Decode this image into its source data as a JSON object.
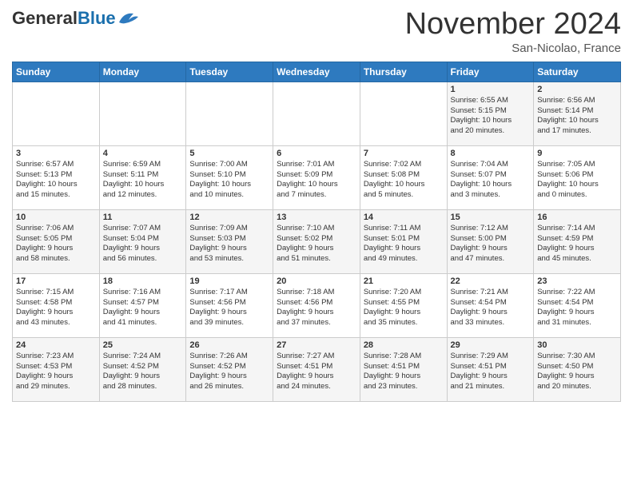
{
  "header": {
    "logo_general": "General",
    "logo_blue": "Blue",
    "month_title": "November 2024",
    "location": "San-Nicolao, France"
  },
  "calendar": {
    "days_of_week": [
      "Sunday",
      "Monday",
      "Tuesday",
      "Wednesday",
      "Thursday",
      "Friday",
      "Saturday"
    ],
    "weeks": [
      [
        {
          "day": "",
          "info": ""
        },
        {
          "day": "",
          "info": ""
        },
        {
          "day": "",
          "info": ""
        },
        {
          "day": "",
          "info": ""
        },
        {
          "day": "",
          "info": ""
        },
        {
          "day": "1",
          "info": "Sunrise: 6:55 AM\nSunset: 5:15 PM\nDaylight: 10 hours\nand 20 minutes."
        },
        {
          "day": "2",
          "info": "Sunrise: 6:56 AM\nSunset: 5:14 PM\nDaylight: 10 hours\nand 17 minutes."
        }
      ],
      [
        {
          "day": "3",
          "info": "Sunrise: 6:57 AM\nSunset: 5:13 PM\nDaylight: 10 hours\nand 15 minutes."
        },
        {
          "day": "4",
          "info": "Sunrise: 6:59 AM\nSunset: 5:11 PM\nDaylight: 10 hours\nand 12 minutes."
        },
        {
          "day": "5",
          "info": "Sunrise: 7:00 AM\nSunset: 5:10 PM\nDaylight: 10 hours\nand 10 minutes."
        },
        {
          "day": "6",
          "info": "Sunrise: 7:01 AM\nSunset: 5:09 PM\nDaylight: 10 hours\nand 7 minutes."
        },
        {
          "day": "7",
          "info": "Sunrise: 7:02 AM\nSunset: 5:08 PM\nDaylight: 10 hours\nand 5 minutes."
        },
        {
          "day": "8",
          "info": "Sunrise: 7:04 AM\nSunset: 5:07 PM\nDaylight: 10 hours\nand 3 minutes."
        },
        {
          "day": "9",
          "info": "Sunrise: 7:05 AM\nSunset: 5:06 PM\nDaylight: 10 hours\nand 0 minutes."
        }
      ],
      [
        {
          "day": "10",
          "info": "Sunrise: 7:06 AM\nSunset: 5:05 PM\nDaylight: 9 hours\nand 58 minutes."
        },
        {
          "day": "11",
          "info": "Sunrise: 7:07 AM\nSunset: 5:04 PM\nDaylight: 9 hours\nand 56 minutes."
        },
        {
          "day": "12",
          "info": "Sunrise: 7:09 AM\nSunset: 5:03 PM\nDaylight: 9 hours\nand 53 minutes."
        },
        {
          "day": "13",
          "info": "Sunrise: 7:10 AM\nSunset: 5:02 PM\nDaylight: 9 hours\nand 51 minutes."
        },
        {
          "day": "14",
          "info": "Sunrise: 7:11 AM\nSunset: 5:01 PM\nDaylight: 9 hours\nand 49 minutes."
        },
        {
          "day": "15",
          "info": "Sunrise: 7:12 AM\nSunset: 5:00 PM\nDaylight: 9 hours\nand 47 minutes."
        },
        {
          "day": "16",
          "info": "Sunrise: 7:14 AM\nSunset: 4:59 PM\nDaylight: 9 hours\nand 45 minutes."
        }
      ],
      [
        {
          "day": "17",
          "info": "Sunrise: 7:15 AM\nSunset: 4:58 PM\nDaylight: 9 hours\nand 43 minutes."
        },
        {
          "day": "18",
          "info": "Sunrise: 7:16 AM\nSunset: 4:57 PM\nDaylight: 9 hours\nand 41 minutes."
        },
        {
          "day": "19",
          "info": "Sunrise: 7:17 AM\nSunset: 4:56 PM\nDaylight: 9 hours\nand 39 minutes."
        },
        {
          "day": "20",
          "info": "Sunrise: 7:18 AM\nSunset: 4:56 PM\nDaylight: 9 hours\nand 37 minutes."
        },
        {
          "day": "21",
          "info": "Sunrise: 7:20 AM\nSunset: 4:55 PM\nDaylight: 9 hours\nand 35 minutes."
        },
        {
          "day": "22",
          "info": "Sunrise: 7:21 AM\nSunset: 4:54 PM\nDaylight: 9 hours\nand 33 minutes."
        },
        {
          "day": "23",
          "info": "Sunrise: 7:22 AM\nSunset: 4:54 PM\nDaylight: 9 hours\nand 31 minutes."
        }
      ],
      [
        {
          "day": "24",
          "info": "Sunrise: 7:23 AM\nSunset: 4:53 PM\nDaylight: 9 hours\nand 29 minutes."
        },
        {
          "day": "25",
          "info": "Sunrise: 7:24 AM\nSunset: 4:52 PM\nDaylight: 9 hours\nand 28 minutes."
        },
        {
          "day": "26",
          "info": "Sunrise: 7:26 AM\nSunset: 4:52 PM\nDaylight: 9 hours\nand 26 minutes."
        },
        {
          "day": "27",
          "info": "Sunrise: 7:27 AM\nSunset: 4:51 PM\nDaylight: 9 hours\nand 24 minutes."
        },
        {
          "day": "28",
          "info": "Sunrise: 7:28 AM\nSunset: 4:51 PM\nDaylight: 9 hours\nand 23 minutes."
        },
        {
          "day": "29",
          "info": "Sunrise: 7:29 AM\nSunset: 4:51 PM\nDaylight: 9 hours\nand 21 minutes."
        },
        {
          "day": "30",
          "info": "Sunrise: 7:30 AM\nSunset: 4:50 PM\nDaylight: 9 hours\nand 20 minutes."
        }
      ]
    ]
  }
}
